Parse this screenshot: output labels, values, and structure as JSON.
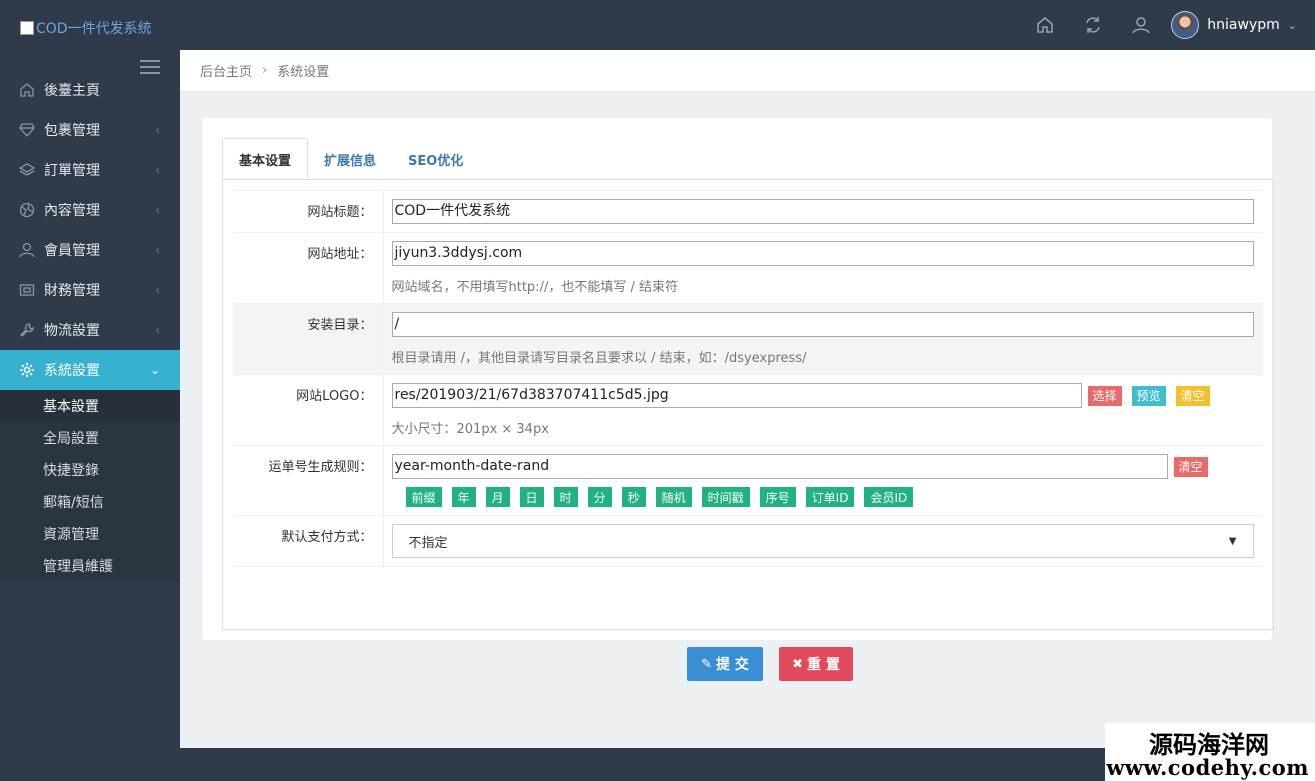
{
  "header": {
    "logo_alt": "COD一件代发系统",
    "username": "hniawypm",
    "icons": [
      "home-icon",
      "refresh-icon",
      "user-icon"
    ]
  },
  "sidebar": {
    "items": [
      {
        "label": "後臺主頁",
        "icon": "home-icon"
      },
      {
        "label": "包裹管理",
        "icon": "diamond-icon"
      },
      {
        "label": "訂單管理",
        "icon": "layers-icon"
      },
      {
        "label": "內容管理",
        "icon": "globe-icon"
      },
      {
        "label": "會員管理",
        "icon": "user-icon"
      },
      {
        "label": "財務管理",
        "icon": "finance-icon"
      },
      {
        "label": "物流設置",
        "icon": "wrench-icon"
      },
      {
        "label": "系統設置",
        "icon": "gear-icon"
      }
    ],
    "subitems": [
      "基本設置",
      "全局設置",
      "快捷登錄",
      "郵箱/短信",
      "資源管理",
      "管理員維護"
    ]
  },
  "breadcrumb": {
    "home": "后台主页",
    "current": "系统设置"
  },
  "tabs": [
    "基本设置",
    "扩展信息",
    "SEO优化"
  ],
  "form": {
    "site_title": {
      "label": "网站标题：",
      "value": "COD一件代发系统"
    },
    "site_url": {
      "label": "网站地址：",
      "value": "jiyun3.3ddysj.com",
      "help": "网站域名，不用填写http://，也不能填写 / 结束符"
    },
    "install_dir": {
      "label": "安装目录：",
      "value": "/",
      "help": "根目录请用 /，其他目录请写目录名且要求以 / 结束，如：/dsyexpress/"
    },
    "logo": {
      "label": "网站LOGO：",
      "value": "res/201903/21/67d383707411c5d5.jpg",
      "help": "大小尺寸：201px × 34px",
      "btn_select": "选择",
      "btn_preview": "预览",
      "btn_clear": "清空"
    },
    "waybill": {
      "label": "运单号生成规则：",
      "value": "year-month-date-rand",
      "btn_clear": "清空",
      "tags": [
        "前缀",
        "年",
        "月",
        "日",
        "时",
        "分",
        "秒",
        "随机",
        "时间戳",
        "序号",
        "订单ID",
        "会员ID"
      ]
    },
    "payment": {
      "label": "默认支付方式：",
      "selected": "不指定"
    }
  },
  "buttons": {
    "submit": "提 交",
    "reset": "重 置"
  },
  "watermark": {
    "line1": "源码海洋网",
    "line2": "www.codehy.com"
  },
  "colors": {
    "accent": "#36b2d0",
    "sidebar_bg": "#2f3b4a",
    "submit": "#3a8fd4",
    "reset": "#e14a5a",
    "tag": "#20b27f"
  }
}
